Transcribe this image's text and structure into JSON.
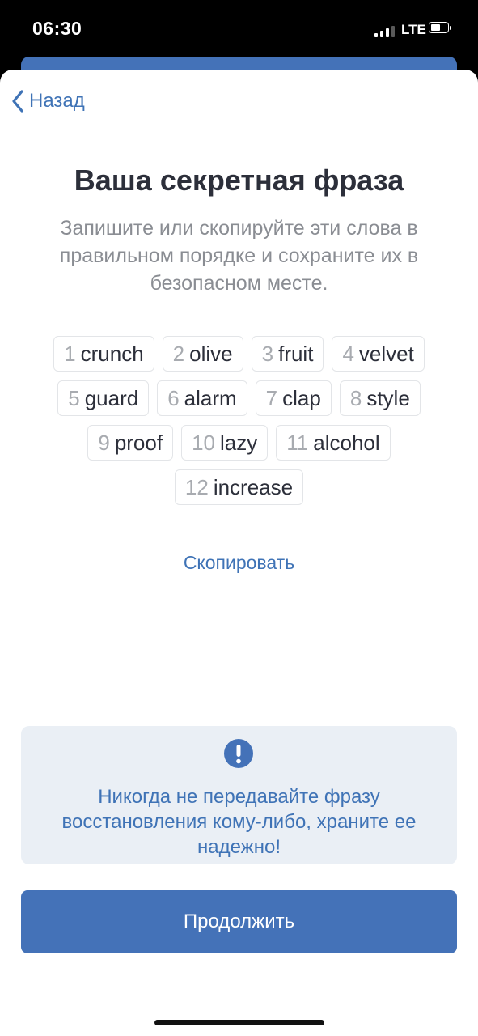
{
  "status_bar": {
    "time": "06:30",
    "network": "LTE",
    "signal_bars_active": 3,
    "signal_bars_total": 4,
    "battery_level": 0.5
  },
  "nav": {
    "back_label": "Назад",
    "back_icon": "chevron-left-icon"
  },
  "title": "Ваша секретная фраза",
  "subtitle": "Запишите или скопируйте эти слова в правильном порядке и сохраните их в безопасном месте.",
  "phrase_rows": [
    [
      {
        "num": "1",
        "word": "crunch"
      },
      {
        "num": "2",
        "word": "olive"
      },
      {
        "num": "3",
        "word": "fruit"
      },
      {
        "num": "4",
        "word": "velvet"
      }
    ],
    [
      {
        "num": "5",
        "word": "guard"
      },
      {
        "num": "6",
        "word": "alarm"
      },
      {
        "num": "7",
        "word": "clap"
      },
      {
        "num": "8",
        "word": "style"
      }
    ],
    [
      {
        "num": "9",
        "word": "proof"
      },
      {
        "num": "10",
        "word": "lazy"
      },
      {
        "num": "11",
        "word": "alcohol"
      }
    ],
    [
      {
        "num": "12",
        "word": "increase"
      }
    ]
  ],
  "copy_label": "Скопировать",
  "warning": {
    "icon": "exclamation-circle-icon",
    "text": "Никогда не передавайте фразу восстановления кому-либо, храните ее надежно!"
  },
  "continue_label": "Продолжить",
  "colors": {
    "accent": "#4472b8",
    "link": "#3f73b6",
    "title": "#2c2f3a",
    "muted": "#8a8d93",
    "warning_bg": "#eaeff5"
  }
}
